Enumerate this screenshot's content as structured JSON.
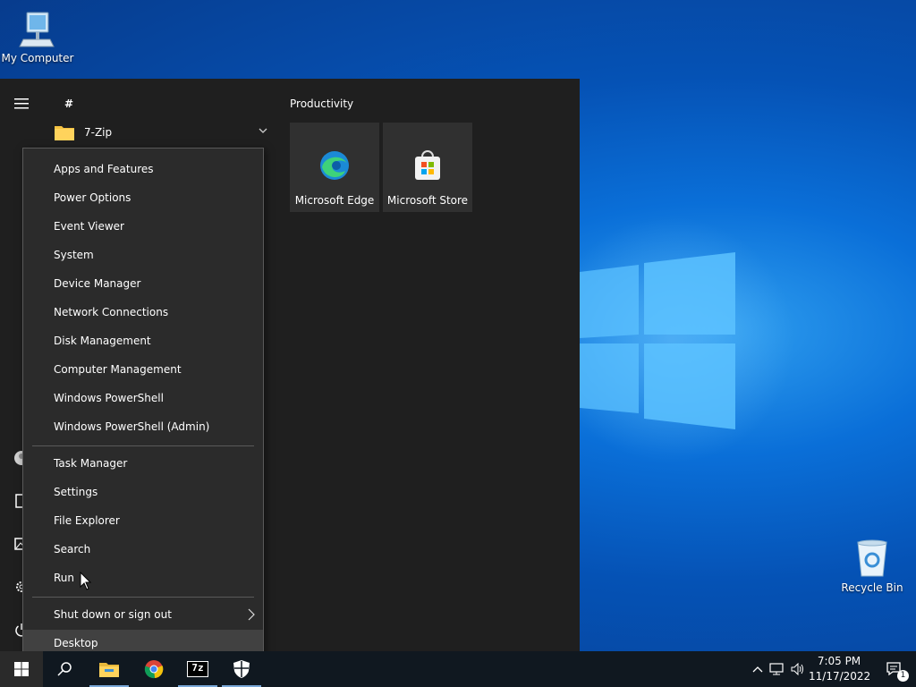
{
  "desktop": {
    "icons": [
      {
        "label": "My Computer",
        "icon": "computer-icon"
      },
      {
        "label": "Recycle Bin",
        "icon": "recycle-bin-icon"
      }
    ]
  },
  "start_menu": {
    "section_letter": "#",
    "app_list": [
      {
        "label": "7-Zip",
        "icon": "folder-icon",
        "expandable": true
      }
    ],
    "tile_group": {
      "title": "Productivity",
      "tiles": [
        {
          "label": "Microsoft Edge",
          "icon": "edge-icon"
        },
        {
          "label": "Microsoft Store",
          "icon": "store-icon"
        }
      ]
    },
    "rail_icons": [
      "hamburger-menu-icon",
      "user-icon",
      "documents-icon",
      "pictures-icon",
      "settings-icon",
      "power-icon"
    ]
  },
  "context_menu": {
    "groups": [
      [
        "Apps and Features",
        "Power Options",
        "Event Viewer",
        "System",
        "Device Manager",
        "Network Connections",
        "Disk Management",
        "Computer Management",
        "Windows PowerShell",
        "Windows PowerShell (Admin)"
      ],
      [
        "Task Manager",
        "Settings",
        "File Explorer",
        "Search",
        "Run"
      ],
      [
        "Shut down or sign out",
        "Desktop"
      ]
    ],
    "hovered": "Desktop",
    "submenu_item": "Shut down or sign out"
  },
  "taskbar": {
    "buttons": [
      "windows-start-icon",
      "search-icon",
      "file-explorer-icon",
      "chrome-icon",
      "7zip-icon",
      "security-icon"
    ],
    "tray_icons": [
      "chevron-up-icon",
      "network-icon",
      "volume-icon"
    ],
    "time": "7:05 PM",
    "date": "11/17/2022",
    "seven_zip_label": "7z",
    "notification_count": "1"
  },
  "colors": {
    "menu_bg": "#1f1f1f",
    "context_bg": "#2b2b2b",
    "taskbar_bg": "#101820",
    "accent": "#0078d7"
  }
}
